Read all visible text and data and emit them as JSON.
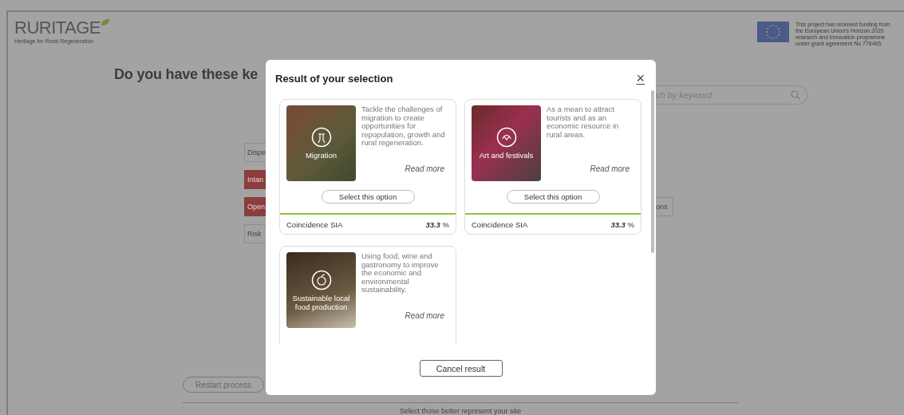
{
  "header": {
    "logo": {
      "wordmark": "RURITAGE",
      "tagline": "Heritage for Rural Regeneration"
    },
    "funding_note": "This project has received funding from the European Union's Horizon 2020 research and innovation programme under grant agreement No 776465."
  },
  "page": {
    "heading": "Do you have these ke",
    "search": {
      "placeholder": "ch by keyword"
    },
    "tags": [
      {
        "label": "Dispe",
        "selected": false
      },
      {
        "label": "Intan",
        "selected": true
      },
      {
        "label": "Open",
        "selected": true
      },
      {
        "label": "Risk",
        "selected": false
      }
    ],
    "right_tag": {
      "label": "ons",
      "selected": false
    },
    "restart_button": "Restart process",
    "footer_hint": "Select those better represent your site"
  },
  "modal": {
    "title": "Result of your selection",
    "close": "×",
    "cards": [
      {
        "image_label": "Migration",
        "description": "Tackle the challenges of migration to create opportunities for repopulation, growth and rural regeneration.",
        "read_more": "Read more",
        "select_label": "Select this option",
        "coincidence_label": "Coincidence SIA",
        "coincidence_value": "**33.3** %"
      },
      {
        "image_label": "Art and festivals",
        "description": "As a mean to attract tourists and as an economic resource in rural areas.",
        "read_more": "Read more",
        "select_label": "Select this option",
        "coincidence_label": "Coincidence SIA",
        "coincidence_value": "**33.3** %"
      },
      {
        "image_label": "Sustainable local food production",
        "description": "Using food, wine and gastronomy to improve the economic and environmental sustainability.",
        "read_more": "Read more"
      }
    ],
    "cancel_button": "Cancel result"
  }
}
